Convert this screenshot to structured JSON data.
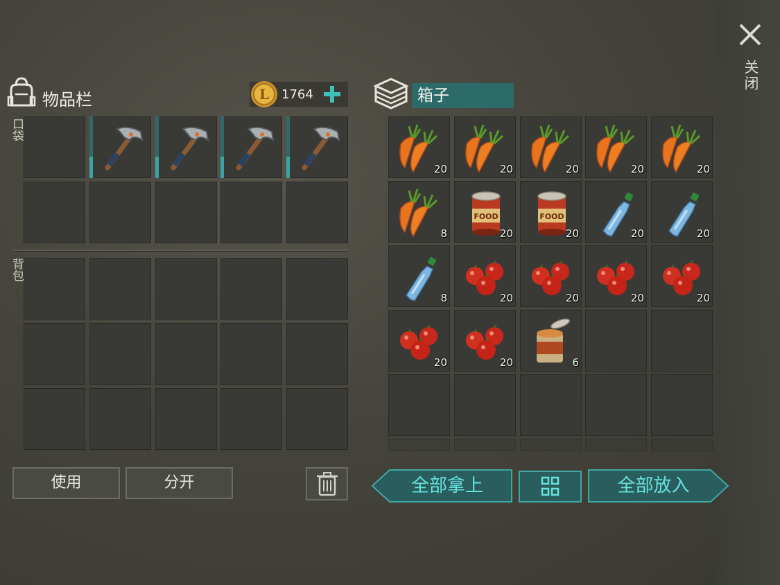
{
  "close": {
    "label": "关闭"
  },
  "inventory": {
    "title": "物品栏",
    "coins": "1764",
    "pocket_label": "口袋",
    "backpack_label": "背包",
    "pocket_slots": [
      {
        "item": null
      },
      {
        "item": "pickaxe-icon",
        "durability": 0.35
      },
      {
        "item": "pickaxe-icon",
        "durability": 0.35
      },
      {
        "item": "pickaxe-icon",
        "durability": 0.35
      },
      {
        "item": "pickaxe-icon",
        "durability": 0.35
      }
    ]
  },
  "box": {
    "title": "箱子",
    "slots": [
      {
        "item": "carrot-icon",
        "qty": "20"
      },
      {
        "item": "carrot-icon",
        "qty": "20"
      },
      {
        "item": "carrot-icon",
        "qty": "20"
      },
      {
        "item": "carrot-icon",
        "qty": "20"
      },
      {
        "item": "carrot-icon",
        "qty": "20"
      },
      {
        "item": "carrot-icon",
        "qty": "8"
      },
      {
        "item": "canned-food-icon",
        "qty": "20"
      },
      {
        "item": "canned-food-icon",
        "qty": "20"
      },
      {
        "item": "water-bottle-icon",
        "qty": "20"
      },
      {
        "item": "water-bottle-icon",
        "qty": "20"
      },
      {
        "item": "water-bottle-icon",
        "qty": "8"
      },
      {
        "item": "tomato-icon",
        "qty": "20"
      },
      {
        "item": "tomato-icon",
        "qty": "20"
      },
      {
        "item": "tomato-icon",
        "qty": "20"
      },
      {
        "item": "tomato-icon",
        "qty": "20"
      },
      {
        "item": "tomato-icon",
        "qty": "20"
      },
      {
        "item": "tomato-icon",
        "qty": "20"
      },
      {
        "item": "opened-can-icon",
        "qty": "6"
      }
    ]
  },
  "buttons": {
    "use": "使用",
    "split": "分开",
    "take_all": "全部拿上",
    "put_all": "全部放入"
  },
  "colors": {
    "accent": "#2d6b6b",
    "accent_text": "#67e3de",
    "slot": "#393a36"
  }
}
